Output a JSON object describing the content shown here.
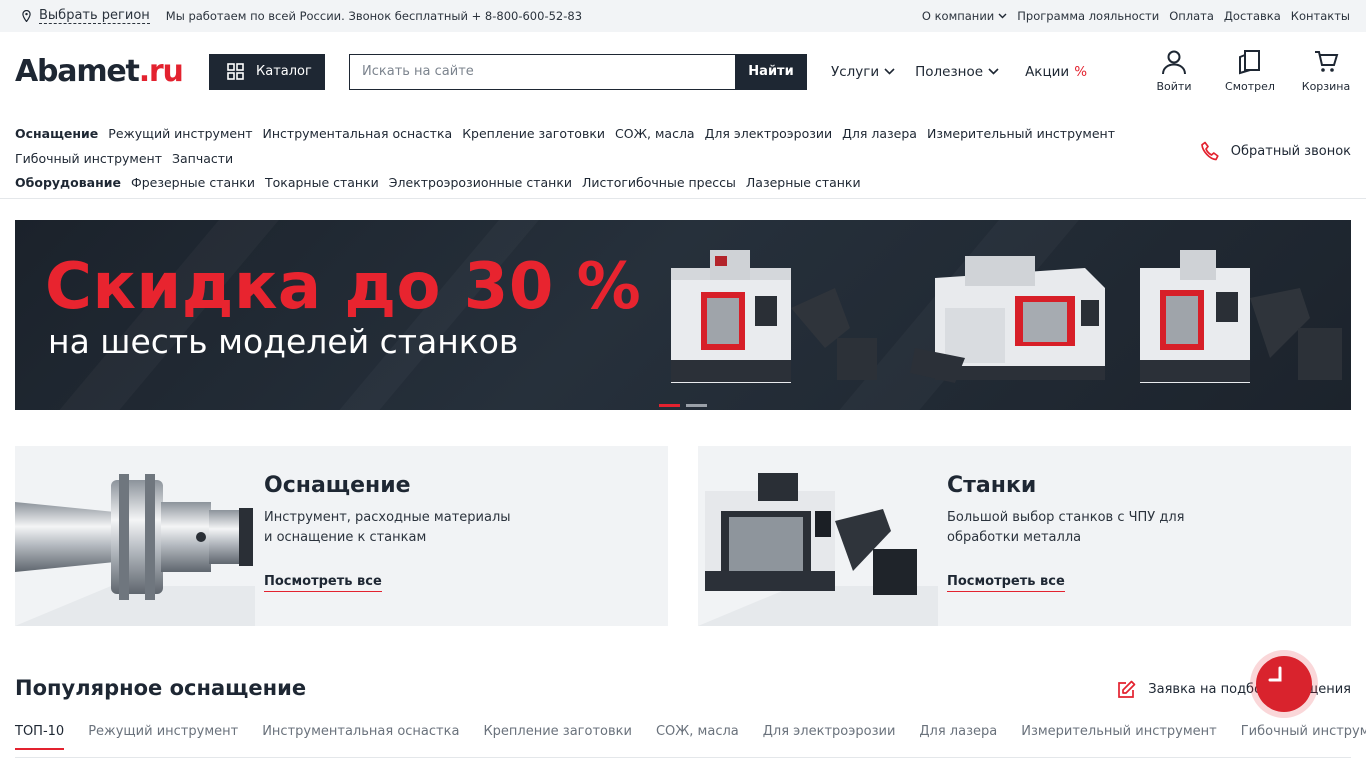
{
  "topbar": {
    "region_label": "Выбрать регион",
    "info": "Мы работаем по всей России. Звонок бесплатный + 8-800-600-52-83",
    "links": [
      "О компании",
      "Программа лояльности",
      "Оплата",
      "Доставка",
      "Контакты"
    ]
  },
  "header": {
    "logo_main": "Abamet",
    "logo_tld": ".ru",
    "catalog_label": "Каталог",
    "search_placeholder": "Искать на сайте",
    "search_button": "Найти",
    "nav": {
      "services": "Услуги",
      "useful": "Полезное",
      "promos": "Акции",
      "promos_symbol": "%"
    },
    "icons": {
      "login": "Войти",
      "viewed": "Смотрел",
      "cart": "Корзина"
    }
  },
  "catmenu": {
    "row1_head": "Оснащение",
    "row1": [
      "Режущий инструмент",
      "Инструментальная оснастка",
      "Крепление заготовки",
      "СОЖ, масла",
      "Для электроэрозии",
      "Для лазера",
      "Измерительный инструмент"
    ],
    "row2": [
      "Гибочный инструмент",
      "Запчасти"
    ],
    "row3_head": "Оборудование",
    "row3": [
      "Фрезерные станки",
      "Токарные станки",
      "Электроэрозионные станки",
      "Листогибочные прессы",
      "Лазерные станки"
    ],
    "callback": "Обратный звонок"
  },
  "banner": {
    "title": "Скидка до 30 %",
    "subtitle": "на шесть моделей станков",
    "slides": [
      true,
      false
    ]
  },
  "cards": [
    {
      "title": "Оснащение",
      "text": "Инструмент, расходные материалы и оснащение к станкам",
      "more": "Посмотреть все"
    },
    {
      "title": "Станки",
      "text": "Большой выбор станков с ЧПУ для обработки металла",
      "more": "Посмотреть все"
    }
  ],
  "popular": {
    "title": "Популярное оснащение",
    "request": "Заявка на подбор оснащения",
    "tabs": [
      "ТОП-10",
      "Режущий инструмент",
      "Инструментальная оснастка",
      "Крепление заготовки",
      "СОЖ, масла",
      "Для электроэрозии",
      "Для лазера",
      "Измерительный инструмент",
      "Гибочный инструмент"
    ]
  },
  "colors": {
    "accent": "#e3222f",
    "dark": "#1e2733",
    "light_bg": "#f1f3f5"
  }
}
